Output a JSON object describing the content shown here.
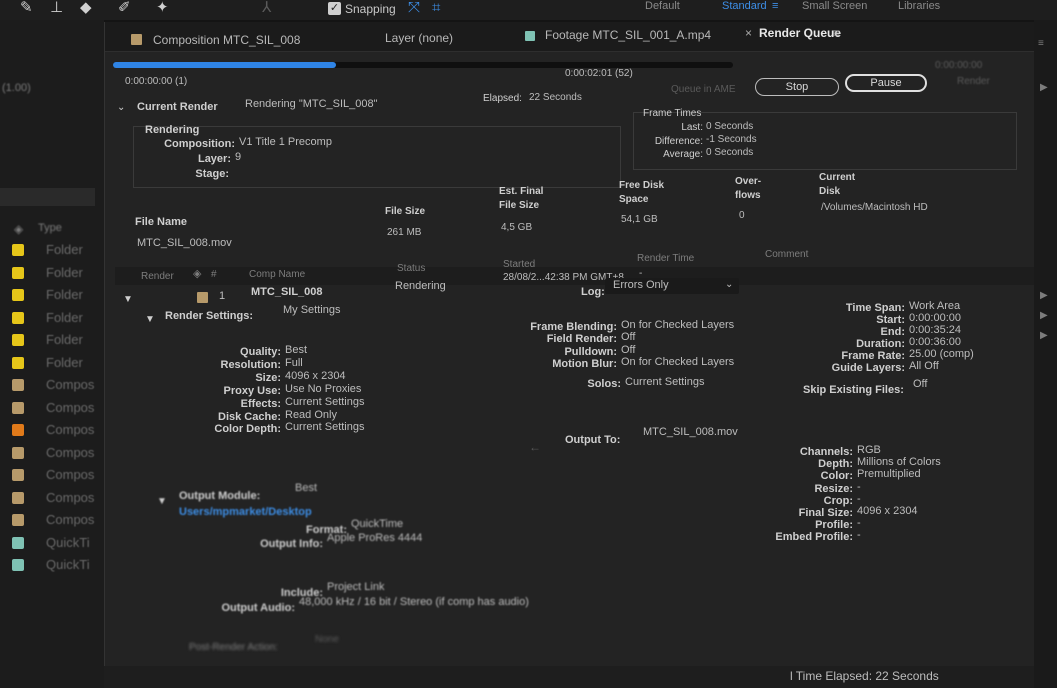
{
  "toolbar": {
    "snapping_label": "Snapping",
    "workspaces": [
      "Default",
      "Standard",
      "Small Screen",
      "Libraries"
    ],
    "active_workspace": "Standard"
  },
  "project_panel": {
    "left_value": "(1.00)",
    "type_header": "Type",
    "items": [
      {
        "label": "Folder",
        "color": "#e6c619"
      },
      {
        "label": "Folder",
        "color": "#e6c619"
      },
      {
        "label": "Folder",
        "color": "#e6c619"
      },
      {
        "label": "Folder",
        "color": "#e6c619"
      },
      {
        "label": "Folder",
        "color": "#e6c619"
      },
      {
        "label": "Folder",
        "color": "#e6c619"
      },
      {
        "label": "Compos",
        "color": "#b79a6a"
      },
      {
        "label": "Compos",
        "color": "#b79a6a"
      },
      {
        "label": "Compos",
        "color": "#e07a1a"
      },
      {
        "label": "Compos",
        "color": "#b79a6a"
      },
      {
        "label": "Compos",
        "color": "#b79a6a"
      },
      {
        "label": "Compos",
        "color": "#b79a6a"
      },
      {
        "label": "Compos",
        "color": "#b79a6a"
      },
      {
        "label": "QuickTi",
        "color": "#7fc2b4"
      },
      {
        "label": "QuickTi",
        "color": "#7fc2b4"
      }
    ]
  },
  "tabs": {
    "composition": "Composition MTC_SIL_008",
    "layer": "Layer (none)",
    "footage": "Footage MTC_SIL_001_A.mp4",
    "render_queue": "Render Queue",
    "close_glyph": "×",
    "menu_glyph": "≡"
  },
  "progress": {
    "fraction": 0.36,
    "start_time": "0:00:00:00 (1)",
    "end_time": "0:00:02:01 (52)"
  },
  "buttons": {
    "queue_ame": "Queue in AME",
    "stop": "Stop",
    "pause": "Pause",
    "render": "Render",
    "right_time": "0:00:00:00"
  },
  "current_render": {
    "header": "Current Render",
    "rendering_status": "Rendering \"MTC_SIL_008\"",
    "elapsed_label": "Elapsed:",
    "elapsed_value": "22 Seconds",
    "rendering_title": "Rendering",
    "composition_label": "Composition:",
    "composition_value": "V1 Title 1 Precomp",
    "layer_label": "Layer:",
    "layer_value": "9",
    "stage_label": "Stage:",
    "stage_value": ""
  },
  "frame_times": {
    "title": "Frame Times",
    "last_label": "Last:",
    "last_value": "0 Seconds",
    "difference_label": "Difference:",
    "difference_value": "-1 Seconds",
    "average_label": "Average:",
    "average_value": "0 Seconds"
  },
  "file_info": {
    "file_name_header": "File Name",
    "file_size_header": "File Size",
    "est_final_header_1": "Est. Final",
    "est_final_header_2": "File Size",
    "free_disk_header_1": "Free Disk",
    "free_disk_header_2": "Space",
    "overflows_header_1": "Over-",
    "overflows_header_2": "flows",
    "current_disk_header_1": "Current",
    "current_disk_header_2": "Disk",
    "file_name": "MTC_SIL_008.mov",
    "file_size": "261 MB",
    "est_final": "4,5 GB",
    "free_disk": "54,1 GB",
    "overflows": "0",
    "current_disk": "/Volumes/Macintosh HD"
  },
  "queue_columns": {
    "render": "Render",
    "number": "#",
    "comp_name": "Comp Name",
    "status": "Status",
    "started": "Started",
    "render_time": "Render Time",
    "comment": "Comment"
  },
  "queue_item": {
    "number": "1",
    "comp_name": "MTC_SIL_008",
    "status": "Rendering",
    "started": "28/08/2...42:38 PM GMT+8",
    "render_time": "-",
    "log_label": "Log:",
    "log_value": "Errors Only",
    "label_color": "#b79a6a"
  },
  "render_settings": {
    "label": "Render Settings:",
    "value": "My Settings",
    "quality_label": "Quality:",
    "quality_value": "Best",
    "resolution_label": "Resolution:",
    "resolution_value": "Full",
    "size_label": "Size:",
    "size_value": "4096 x 2304",
    "proxy_label": "Proxy Use:",
    "proxy_value": "Use No Proxies",
    "effects_label": "Effects:",
    "effects_value": "Current Settings",
    "disk_cache_label": "Disk Cache:",
    "disk_cache_value": "Read Only",
    "color_depth_label": "Color Depth:",
    "color_depth_value": "Current Settings",
    "frame_blending_label": "Frame Blending:",
    "frame_blending_value": "On for Checked Layers",
    "field_render_label": "Field Render:",
    "field_render_value": "Off",
    "pulldown_label": "Pulldown:",
    "pulldown_value": "Off",
    "motion_blur_label": "Motion Blur:",
    "motion_blur_value": "On for Checked Layers",
    "solos_label": "Solos:",
    "solos_value": "Current Settings",
    "time_span_label": "Time Span:",
    "time_span_value": "Work Area",
    "start_label": "Start:",
    "start_value": "0:00:00:00",
    "end_label": "End:",
    "end_value": "0:00:35:24",
    "duration_label": "Duration:",
    "duration_value": "0:00:36:00",
    "frame_rate_label": "Frame Rate:",
    "frame_rate_value": "25.00 (comp)",
    "guide_layers_label": "Guide Layers:",
    "guide_layers_value": "All Off",
    "skip_existing_label": "Skip Existing Files:",
    "skip_existing_value": "Off"
  },
  "output": {
    "output_to_label": "Output To:",
    "output_to_value": "MTC_SIL_008.mov",
    "arrow_glyph": "←"
  },
  "output_module": {
    "label": "Output Module:",
    "value": "Best",
    "path": "Users/mpmarket/Desktop",
    "format_label": "Format:",
    "format_value": "QuickTime",
    "output_info_label": "Output Info:",
    "output_info_value": "Apple ProRes 4444",
    "include_label": "Include:",
    "include_value": "Project Link",
    "output_audio_label": "Output Audio:",
    "output_audio_value": "48,000 kHz / 16 bit / Stereo (if comp has audio)",
    "channels_label": "Channels:",
    "channels_value": "RGB",
    "depth_label": "Depth:",
    "depth_value": "Millions of Colors",
    "color_label": "Color:",
    "color_value": "Premultiplied",
    "resize_label": "Resize:",
    "resize_value": "-",
    "crop_label": "Crop:",
    "crop_value": "-",
    "final_size_label": "Final Size:",
    "final_size_value": "4096 x 2304",
    "profile_label": "Profile:",
    "profile_value": "-",
    "embed_profile_label": "Embed Profile:",
    "embed_profile_value": "-"
  },
  "post_render": {
    "label": "Post-Render Action:",
    "value": "None"
  },
  "footer": {
    "total_elapsed": "l Time Elapsed: 22 Seconds"
  }
}
